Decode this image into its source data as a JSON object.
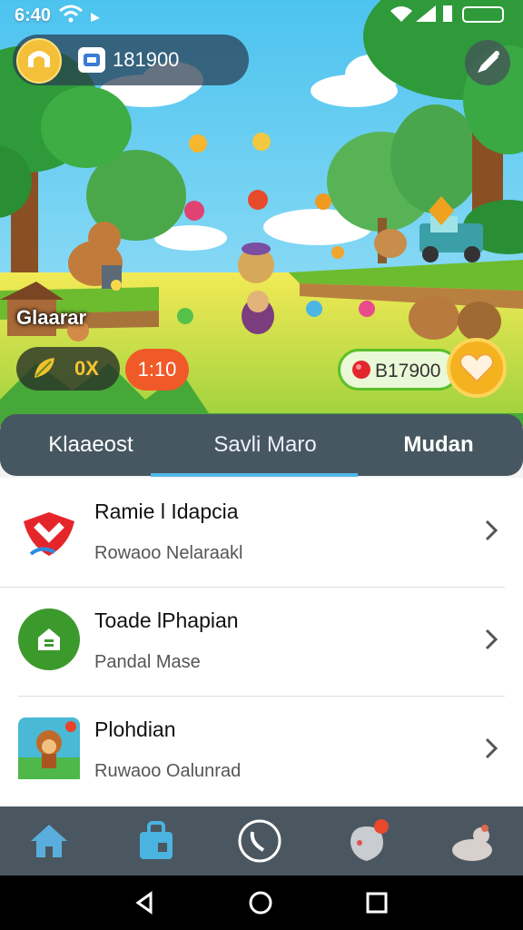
{
  "status": {
    "time": "6:40"
  },
  "hud": {
    "coins": "181900",
    "place_label": "Glaarar",
    "leaf_value": "0X",
    "timer": "1:10",
    "gems": "B17900"
  },
  "tabs": [
    {
      "label": "Klaaeost"
    },
    {
      "label": "Savli Maro"
    },
    {
      "label": "Mudan"
    }
  ],
  "list": [
    {
      "title": "Ramie l Idapcia",
      "subtitle": "Rowaoo Nelaraakl",
      "icon": "red-shield-icon"
    },
    {
      "title": "Toade lPhapian",
      "subtitle": "Pandal Mase",
      "icon": "green-house-icon"
    },
    {
      "title": "Plohdian",
      "subtitle": "Ruwaoo Oalunrad",
      "icon": "monkey-game-icon"
    }
  ],
  "bottom_nav": [
    {
      "icon": "home-icon"
    },
    {
      "icon": "shop-bag-icon"
    },
    {
      "icon": "phone-icon"
    },
    {
      "icon": "ghost-notification-icon"
    },
    {
      "icon": "animal-profile-icon"
    }
  ],
  "colors": {
    "tabbar": "#475761",
    "accent": "#4fb8e8",
    "timer": "#ef5a28",
    "coin": "#f4c03a",
    "gem_border": "#5bbf2a"
  }
}
